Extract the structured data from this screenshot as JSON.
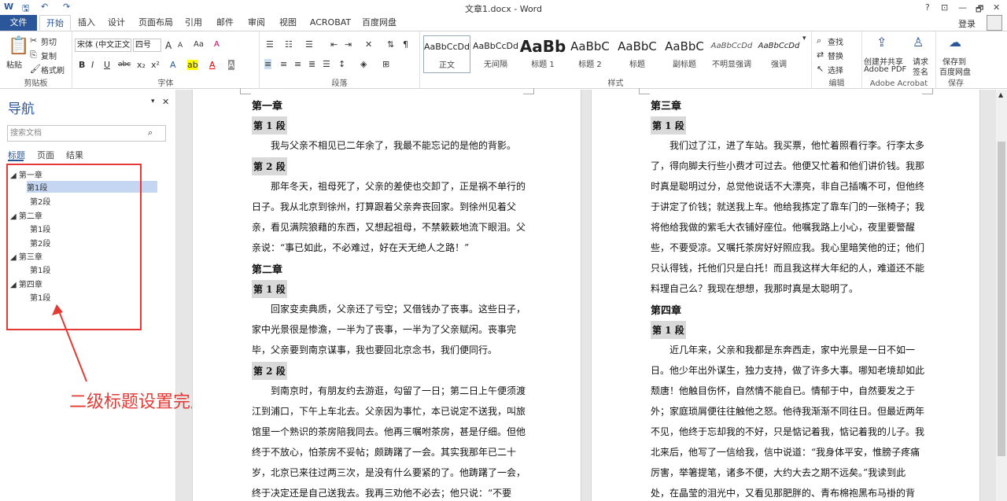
{
  "window": {
    "title": "文章1.docx - Word",
    "help": "?",
    "ribbon_options": "⊡",
    "minimize": "—",
    "restore": "🗗",
    "close": "✕"
  },
  "qat": {
    "undo": "↶",
    "redo": "↷",
    "save": "🖫"
  },
  "tabs": [
    "文件",
    "开始",
    "插入",
    "设计",
    "页面布局",
    "引用",
    "邮件",
    "审阅",
    "视图",
    "ACROBAT",
    "百度网盘"
  ],
  "account": {
    "login": "登录"
  },
  "ribbon": {
    "clipboard": {
      "paste": "粘贴",
      "cut": "剪切",
      "copy": "复制",
      "format_painter": "格式刷",
      "label": "剪贴板"
    },
    "font": {
      "name": "宋体 (中文正文",
      "size": "四号",
      "grow": "A",
      "shrink": "A",
      "case": "Aa",
      "clear": "A",
      "label": "字体"
    },
    "paragraph": {
      "label": "段落"
    },
    "styles": {
      "label": "样式",
      "items": [
        {
          "preview": "AaBbCcDd",
          "name": "正文"
        },
        {
          "preview": "AaBbCcDd",
          "name": "无间隔"
        },
        {
          "preview": "AaBb",
          "name": "标题 1"
        },
        {
          "preview": "AaBbC",
          "name": "标题 2"
        },
        {
          "preview": "AaBbC",
          "name": "标题"
        },
        {
          "preview": "AaBbC",
          "name": "副标题"
        },
        {
          "preview": "AaBbCcDd",
          "name": "不明显强调"
        },
        {
          "preview": "AaBbCcDd",
          "name": "强调"
        }
      ]
    },
    "editing": {
      "find": "查找",
      "replace": "替换",
      "select": "选择",
      "label": "编辑"
    },
    "acrobat": {
      "create": "创建并共享",
      "create2": "Adobe PDF",
      "request": "请求",
      "request2": "签名",
      "label": "Adobe Acrobat"
    },
    "save": {
      "save": "保存到",
      "save2": "百度网盘",
      "label": "保存"
    }
  },
  "nav": {
    "title": "导航",
    "search_placeholder": "搜索文档",
    "tabs": [
      "标题",
      "页面",
      "结果"
    ],
    "tree": [
      {
        "text": "第一章",
        "level": 1
      },
      {
        "text": "第1段",
        "level": 2,
        "selected": true
      },
      {
        "text": "第2段",
        "level": 2
      },
      {
        "text": "第二章",
        "level": 1
      },
      {
        "text": "第1段",
        "level": 2
      },
      {
        "text": "第2段",
        "level": 2
      },
      {
        "text": "第三章",
        "level": 1
      },
      {
        "text": "第1段",
        "level": 2
      },
      {
        "text": "第四章",
        "level": 1
      },
      {
        "text": "第1段",
        "level": 2
      }
    ]
  },
  "annotation": {
    "callout": "二级标题设置完成",
    "color": "#e53935"
  },
  "page1": [
    {
      "t": "chap",
      "text": "第一章"
    },
    {
      "t": "sec",
      "text": "第 1 段"
    },
    {
      "t": "p",
      "text": "　　我与父亲不相见已二年余了，我最不能忘记的是他的背影。"
    },
    {
      "t": "sec",
      "text": "第 2 段"
    },
    {
      "t": "p",
      "text": "　　那年冬天，祖母死了，父亲的差使也交卸了，正是祸不单行的"
    },
    {
      "t": "p",
      "text": "日子。我从北京到徐州，打算跟着父亲奔丧回家。到徐州见着父"
    },
    {
      "t": "p",
      "text": "亲，看见满院狼藉的东西，又想起祖母，不禁簌簌地流下眼泪。父"
    },
    {
      "t": "p",
      "text": "亲说：“事已如此，不必难过，好在天无绝人之路！”"
    },
    {
      "t": "chap",
      "text": "第二章"
    },
    {
      "t": "sec",
      "text": "第 1 段"
    },
    {
      "t": "p",
      "text": "　　回家变卖典质，父亲还了亏空；又借钱办了丧事。这些日子，"
    },
    {
      "t": "p",
      "text": "家中光景很是惨澹，一半为了丧事，一半为了父亲赋闲。丧事完"
    },
    {
      "t": "p",
      "text": "毕，父亲要到南京谋事，我也要回北京念书，我们便同行。"
    },
    {
      "t": "sec",
      "text": "第 2 段"
    },
    {
      "t": "p",
      "text": "　　到南京时，有朋友约去游逛，勾留了一日；第二日上午便须渡"
    },
    {
      "t": "p",
      "text": "江到浦口，下午上车北去。父亲因为事忙，本已说定不送我，叫旅"
    },
    {
      "t": "p",
      "text": "馆里一个熟识的茶房陪我同去。他再三嘱咐茶房，甚是仔细。但他"
    },
    {
      "t": "p",
      "text": "终于不放心，怕茶房不妥帖；颇踌躇了一会。其实我那年已二十"
    },
    {
      "t": "p",
      "text": "岁，北京已来往过两三次，是没有什么要紧的了。他踌躇了一会，"
    },
    {
      "t": "p",
      "text": "终于决定还是自己送我去。我再三劝他不必去；他只说：“不要"
    }
  ],
  "page2": [
    {
      "t": "chap",
      "text": "第三章"
    },
    {
      "t": "sec",
      "text": "第 1 段"
    },
    {
      "t": "p",
      "text": "　　我们过了江，进了车站。我买票，他忙着照看行李。行李太多"
    },
    {
      "t": "p",
      "text": "了，得向脚夫行些小费才可过去。他便又忙着和他们讲价钱。我那"
    },
    {
      "t": "p",
      "text": "时真是聪明过分，总觉他说话不大漂亮，非自己插嘴不可，但他终"
    },
    {
      "t": "p",
      "text": "于讲定了价钱；就送我上车。他给我拣定了靠车门的一张椅子；我"
    },
    {
      "t": "p",
      "text": "将他给我做的紫毛大衣铺好座位。他嘱我路上小心，夜里要警醒"
    },
    {
      "t": "p",
      "text": "些，不要受凉。又嘱托茶房好好照应我。我心里暗笑他的迂；他们"
    },
    {
      "t": "p",
      "text": "只认得钱，托他们只是白托！而且我这样大年纪的人，难道还不能"
    },
    {
      "t": "p",
      "text": "料理自己么？我现在想想，我那时真是太聪明了。"
    },
    {
      "t": "chap",
      "text": "第四章"
    },
    {
      "t": "sec",
      "text": "第 1 段"
    },
    {
      "t": "p",
      "text": "　　近几年来，父亲和我都是东奔西走，家中光景是一日不如一"
    },
    {
      "t": "p",
      "text": "日。他少年出外谋生，独力支持，做了许多大事。哪知老境却如此"
    },
    {
      "t": "p",
      "text": "颓唐！他触目伤怀，自然情不能自已。情郁于中，自然要发之于"
    },
    {
      "t": "p",
      "text": "外；家庭琐屑便往往触他之怒。他待我渐渐不同往日。但最近两年"
    },
    {
      "t": "p",
      "text": "不见，他终于忘却我的不好，只是惦记着我，惦记着我的儿子。我"
    },
    {
      "t": "p",
      "text": "北来后，他写了一信给我，信中说道：“我身体平安，惟膀子疼痛"
    },
    {
      "t": "p",
      "text": "厉害，举箸提笔，诸多不便，大约大去之期不远矣。”我读到此"
    },
    {
      "t": "p",
      "text": "处，在晶莹的泪光中，又看见那肥胖的、青布棉袍黑布马褂的背"
    }
  ]
}
